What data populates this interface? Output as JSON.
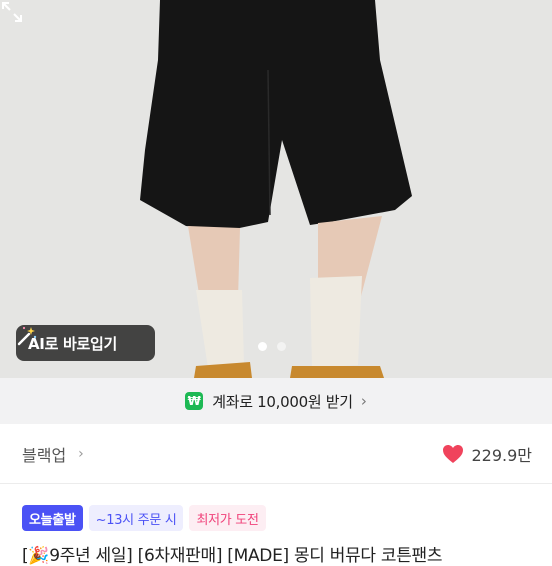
{
  "hero": {
    "ai_button_label": "AI로 바로입기",
    "page_indicator": {
      "total": 2,
      "current": 1
    }
  },
  "promo": {
    "icon_text": "₩",
    "text": "계좌로 10,000원 받기",
    "chevron": "›"
  },
  "seller": {
    "brand": "블랙업",
    "chevron": "›"
  },
  "likes": {
    "count": "229.9만",
    "color": "#f0435c"
  },
  "badges": {
    "today_delivery": "오늘출발",
    "order_deadline": "~13시 주문 시",
    "lowest_price": "최저가 도전"
  },
  "product": {
    "title": "[🎉9주년 세일] [6차재판매] [MADE] 몽디 버뮤다 코튼팬츠"
  },
  "colors": {
    "accent_blue": "#4b52f5",
    "pink": "#f0427a",
    "green": "#1db954"
  }
}
